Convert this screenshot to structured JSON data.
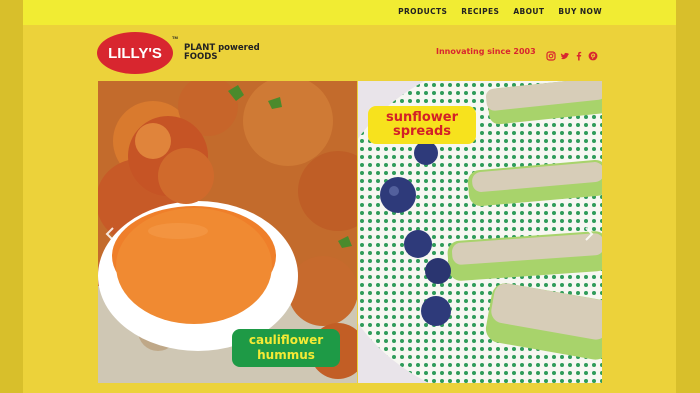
{
  "nav": {
    "items": [
      "PRODUCTS",
      "RECIPES",
      "ABOUT",
      "BUY NOW"
    ]
  },
  "brand": {
    "logo_text": "LILLY'S",
    "trademark": "TM",
    "tagline_line1": "PLANT powered",
    "tagline_line2": "FOODS",
    "innovating": "Innovating since 2003"
  },
  "social": {
    "icons": [
      "instagram-icon",
      "twitter-icon",
      "facebook-icon",
      "pinterest-icon"
    ]
  },
  "hero": {
    "left_label_line1": "cauliflower",
    "left_label_line2": "hummus",
    "right_label_line1": "sunflower",
    "right_label_line2": "spreads",
    "prev_icon": "chevron-left-icon",
    "next_icon": "chevron-right-icon"
  },
  "colors": {
    "page_bg": "#ecd23a",
    "top_bar": "#f1ec33",
    "brand_red": "#d8262f",
    "brand_green": "#1e9a46",
    "label_yellow": "#f7e21d"
  }
}
